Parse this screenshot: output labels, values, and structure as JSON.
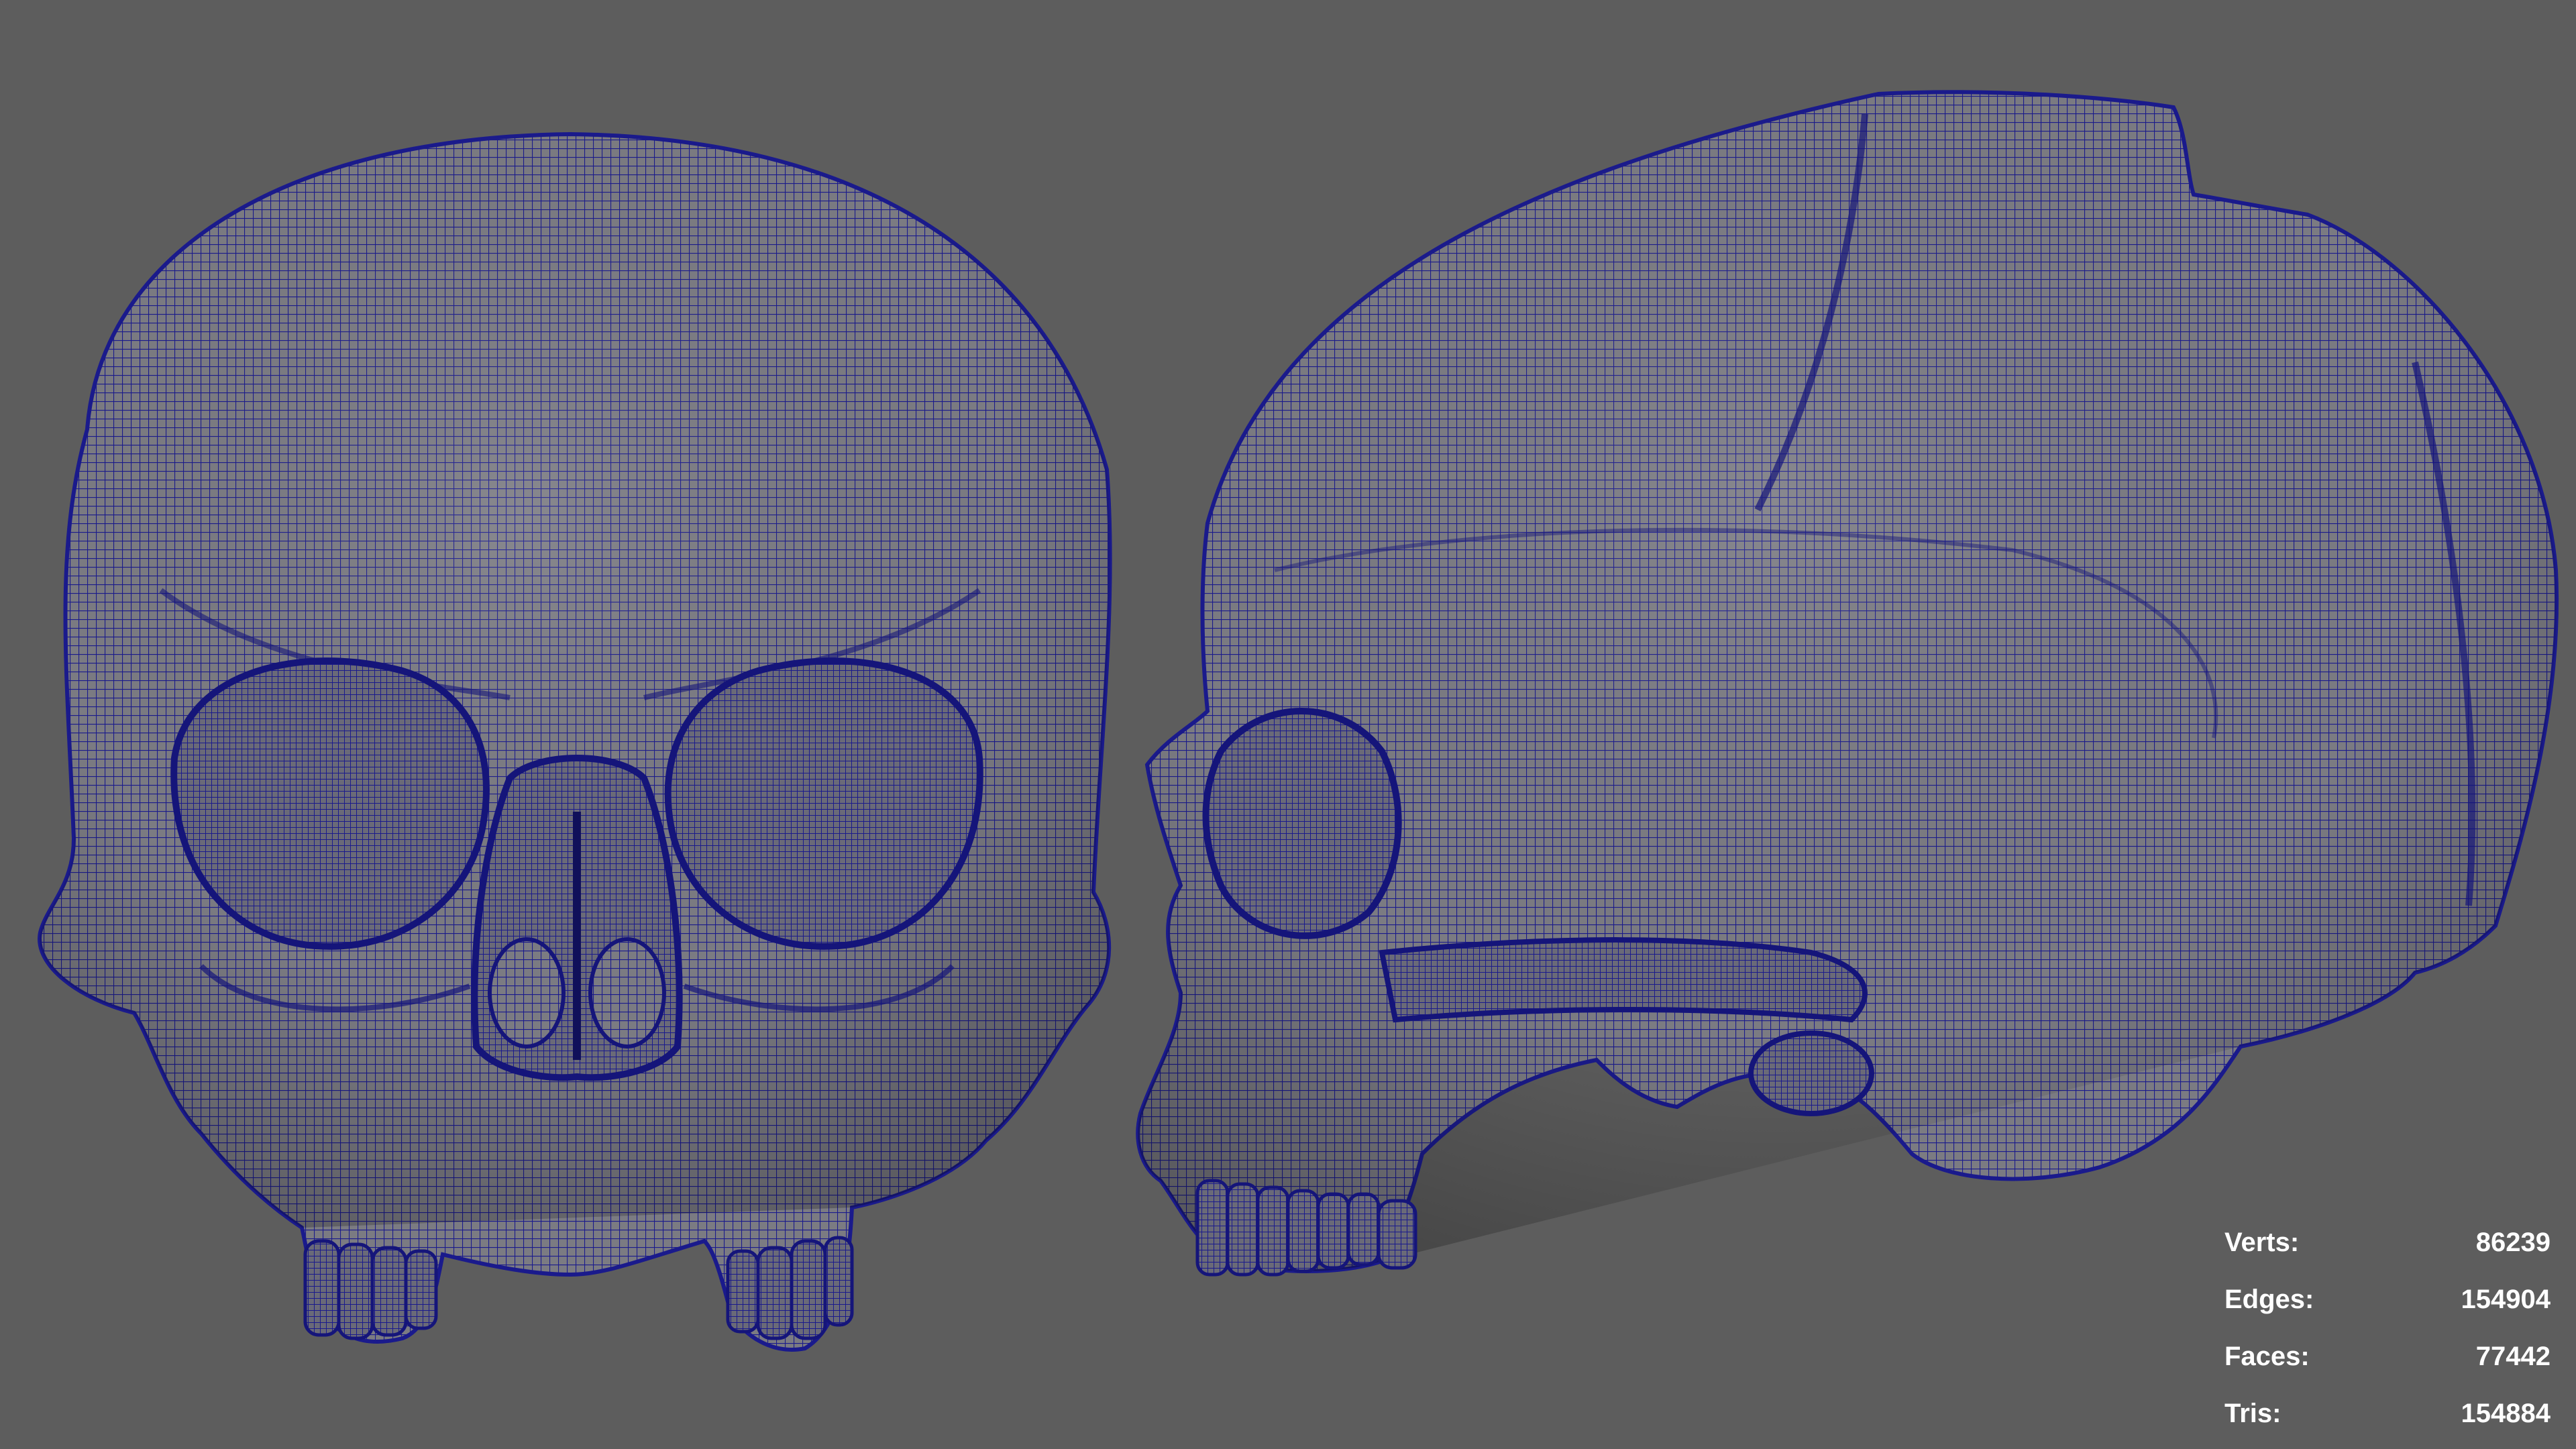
{
  "viewport": {
    "background_color": "#5d5d5d",
    "wireframe_color": "#1a1a8c",
    "surface_color": "#7b7b82",
    "objects": [
      {
        "name": "skull-front-view",
        "view": "front"
      },
      {
        "name": "skull-side-view",
        "view": "side"
      }
    ]
  },
  "heads_up_display": {
    "stats": [
      {
        "label": "Verts:",
        "value": "86239"
      },
      {
        "label": "Edges:",
        "value": "154904"
      },
      {
        "label": "Faces:",
        "value": "77442"
      },
      {
        "label": "Tris:",
        "value": "154884"
      }
    ]
  }
}
